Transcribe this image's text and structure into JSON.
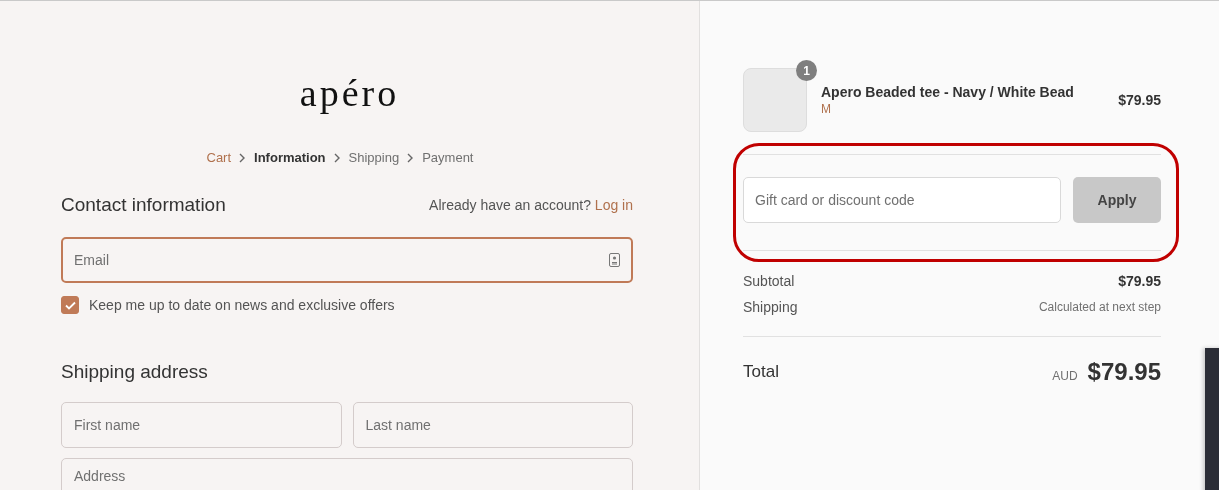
{
  "logo": {
    "text": "apéro"
  },
  "breadcrumb": [
    {
      "label": "Cart",
      "kind": "link"
    },
    {
      "label": "Information",
      "kind": "current"
    },
    {
      "label": "Shipping",
      "kind": "upcoming"
    },
    {
      "label": "Payment",
      "kind": "upcoming"
    }
  ],
  "contact": {
    "heading": "Contact information",
    "account_prompt": "Already have an account?",
    "login_link": "Log in",
    "email": {
      "placeholder": "Email"
    },
    "newsletter": {
      "label": "Keep me up to date on news and exclusive offers",
      "checked": true
    }
  },
  "shipping_address": {
    "heading": "Shipping address",
    "fields": [
      {
        "placeholder": "First name"
      },
      {
        "placeholder": "Last name"
      },
      {
        "placeholder": "Address"
      }
    ]
  },
  "order_summary": {
    "items": [
      {
        "name": "Apero Beaded tee - Navy / White Bead",
        "variant": "M",
        "quantity": "1",
        "price": "$79.95"
      }
    ],
    "discount": {
      "placeholder": "Gift card or discount code",
      "button": "Apply",
      "highlighted": true
    },
    "subtotal": {
      "label": "Subtotal",
      "value": "$79.95"
    },
    "shipping": {
      "label": "Shipping",
      "value": "Calculated at next step"
    },
    "total": {
      "label": "Total",
      "currency": "AUD",
      "value": "$79.95"
    }
  }
}
